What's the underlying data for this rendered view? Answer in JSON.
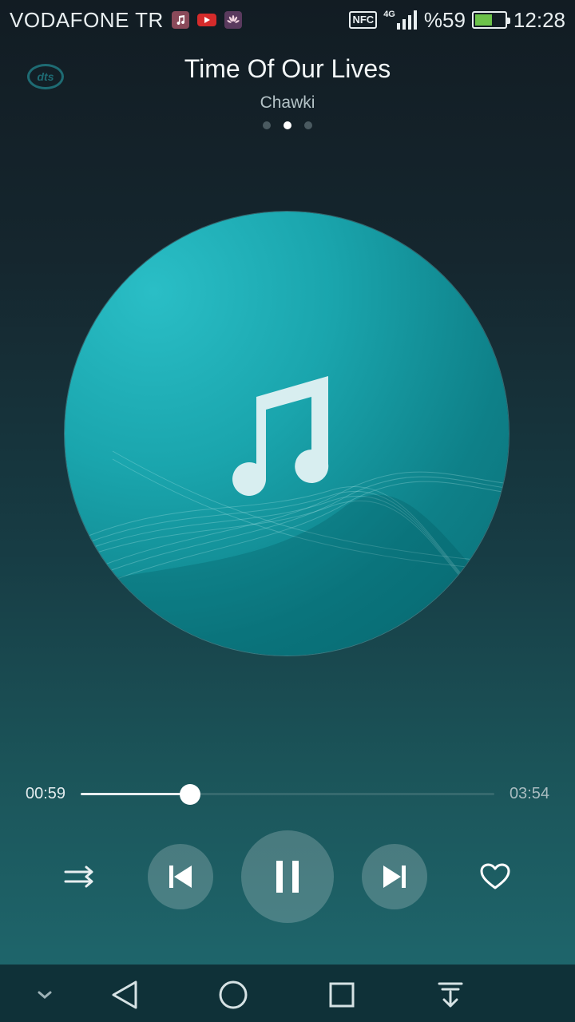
{
  "status_bar": {
    "carrier": "VODAFONE TR",
    "notifications": [
      "music-icon",
      "youtube-icon",
      "huawei-icon"
    ],
    "nfc": "NFC",
    "network": "4G",
    "battery_percent": "%59",
    "battery_level": 0.59,
    "time": "12:28"
  },
  "header": {
    "logo": "dts",
    "title": "Time Of Our Lives",
    "artist": "Chawki",
    "pages": 3,
    "active_page": 2
  },
  "player": {
    "current_time": "00:59",
    "total_time": "03:54",
    "progress": 0.265
  },
  "controls": [
    "shuffle-icon",
    "previous-icon",
    "pause-icon",
    "next-icon",
    "heart-icon"
  ],
  "colors": {
    "accent": "#1aa5ad",
    "album_light": "#2abec6",
    "album_dark": "#0a6f77"
  },
  "nav_bar": [
    "chevron-down-icon",
    "back-icon",
    "home-icon",
    "recents-icon",
    "pull-down-icon"
  ]
}
